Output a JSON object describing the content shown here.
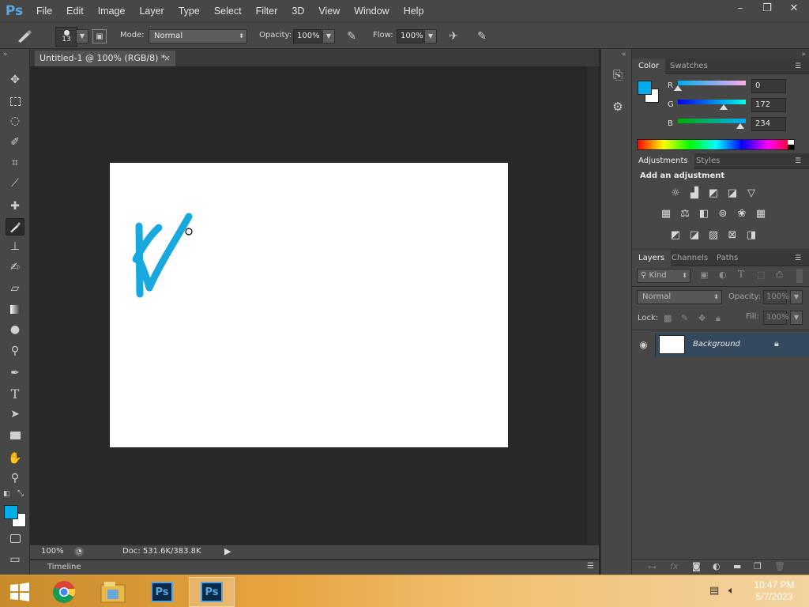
{
  "menubar": {
    "logo": "Ps",
    "items": [
      "File",
      "Edit",
      "Image",
      "Layer",
      "Type",
      "Select",
      "Filter",
      "3D",
      "View",
      "Window",
      "Help"
    ],
    "window_buttons": [
      "–",
      "❐",
      "✕"
    ]
  },
  "options": {
    "brush_size": "13",
    "mode_label": "Mode:",
    "mode_value": "Normal",
    "opacity_label": "Opacity:",
    "opacity_value": "100%",
    "flow_label": "Flow:",
    "flow_value": "100%"
  },
  "document": {
    "tab_title": "Untitled-1 @ 100% (RGB/8) *",
    "zoom": "100%",
    "doc_info": "Doc: 531.6K/383.8K",
    "stroke_color": "#18a8e0",
    "timeline_label": "Timeline"
  },
  "color_panel": {
    "tabs": [
      "Color",
      "Swatches"
    ],
    "r_label": "R",
    "r_value": "0",
    "g_label": "G",
    "g_value": "172",
    "b_label": "B",
    "b_value": "234",
    "r_level": 0.0,
    "g_level": 0.675,
    "b_level": 0.918,
    "foreground": "#00acea",
    "background": "#ffffff"
  },
  "adjustments_panel": {
    "tabs": [
      "Adjustments",
      "Styles"
    ],
    "heading": "Add an adjustment",
    "row1_icons": [
      "brightness-contrast-icon",
      "levels-icon",
      "curves-icon",
      "exposure-icon",
      "vibrance-icon"
    ],
    "row2_icons": [
      "hue-saturation-icon",
      "color-balance-icon",
      "black-white-icon",
      "photo-filter-icon",
      "channel-mixer-icon",
      "color-lookup-icon"
    ],
    "row3_icons": [
      "invert-icon",
      "posterize-icon",
      "threshold-icon",
      "gradient-map-icon",
      "selective-color-icon"
    ]
  },
  "layers_panel": {
    "tabs": [
      "Layers",
      "Channels",
      "Paths"
    ],
    "filter_kind": "Kind",
    "blend_mode": "Normal",
    "opacity_label": "Opacity:",
    "opacity_value": "100%",
    "lock_label": "Lock:",
    "fill_label": "Fill:",
    "fill_value": "100%",
    "layers": [
      {
        "name": "Background",
        "visible": true,
        "locked": true
      }
    ]
  },
  "taskbar": {
    "apps": [
      "start-button",
      "chrome-icon",
      "file-explorer-icon",
      "photoshop-icon",
      "photoshop-icon"
    ],
    "time": "10:47 PM",
    "date": "5/7/2023"
  }
}
